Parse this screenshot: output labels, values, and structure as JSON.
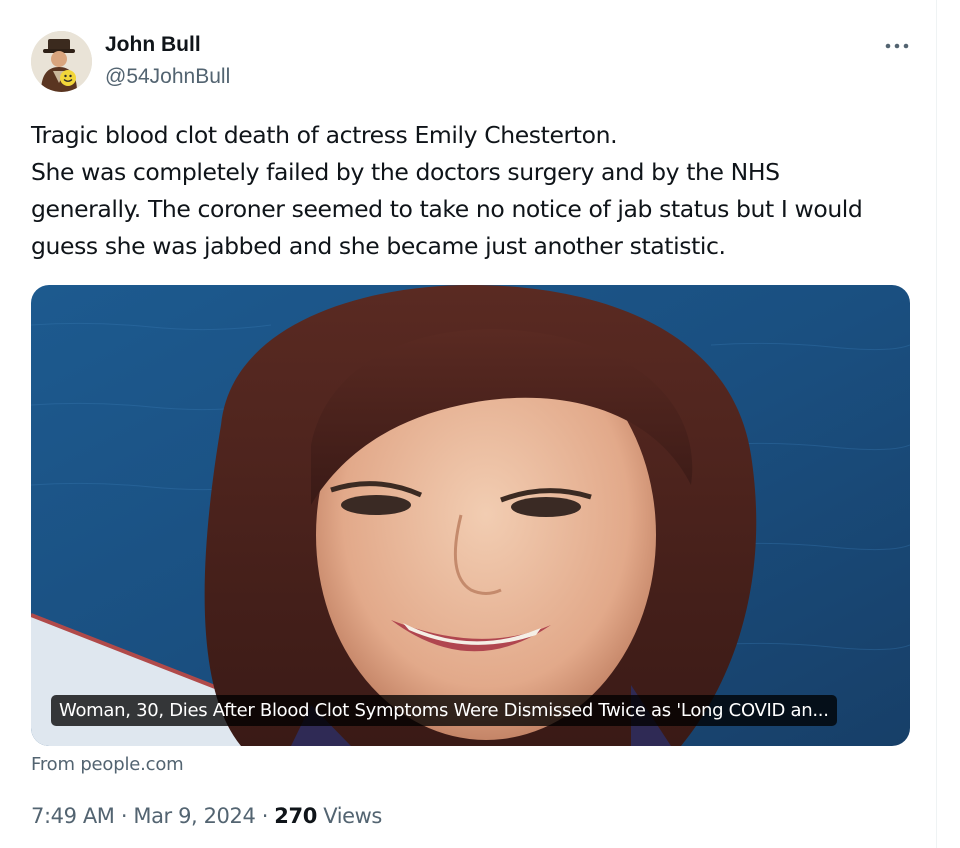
{
  "tweet": {
    "author": {
      "name": "John Bull",
      "handle": "@54JohnBull"
    },
    "more_icon": "more-dots-icon",
    "text_lines": [
      "Tragic blood clot death of actress Emily Chesterton.",
      "She was completely failed by the doctors surgery and by the NHS",
      "generally. The coroner seemed to take no notice of jab status but I would",
      "guess she was jabbed and she became just another statistic."
    ],
    "card": {
      "caption": "Woman, 30, Dies After Blood Clot Symptoms Were Dismissed Twice as 'Long COVID an...",
      "source": "From people.com"
    },
    "time": "7:49 AM",
    "separator": "·",
    "date": "Mar 9, 2024",
    "views_count": "270",
    "views_label": " Views"
  },
  "colors": {
    "text_primary": "#0f1419",
    "text_secondary": "#536471",
    "border": "#eff3f4"
  }
}
